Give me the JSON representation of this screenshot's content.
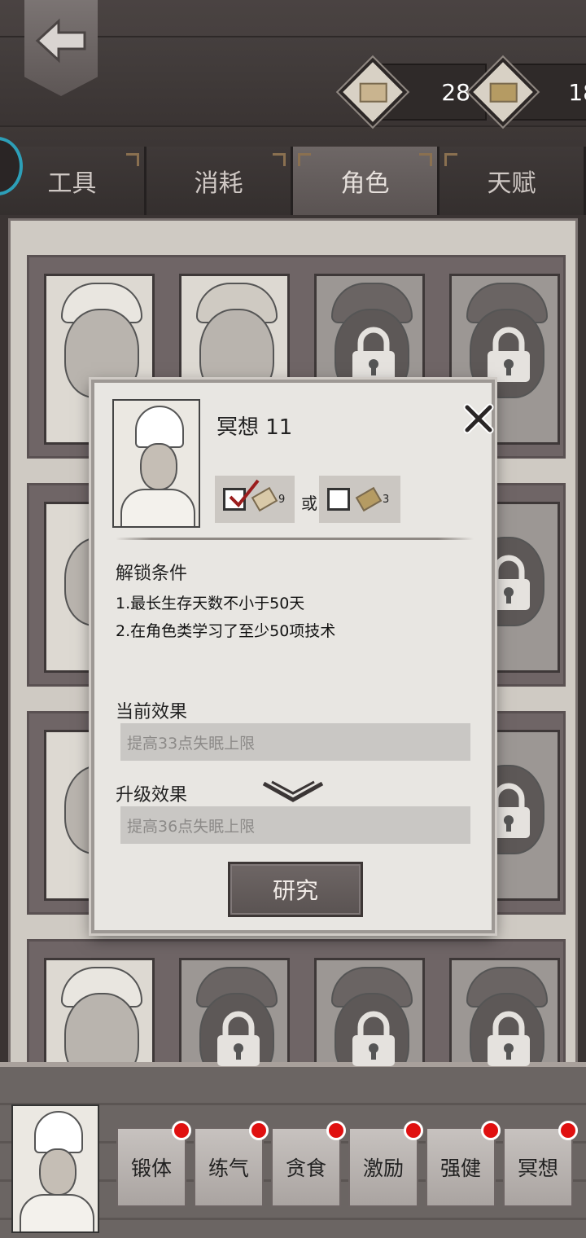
{
  "currencies": [
    {
      "icon": "scroll-icon",
      "value": "28"
    },
    {
      "icon": "book-icon",
      "value": "18"
    }
  ],
  "tabs": [
    "工具",
    "消耗",
    "角色",
    "天赋"
  ],
  "active_tab": "角色",
  "popup": {
    "title": "冥想 11",
    "cost_primary": {
      "icon": "scroll-icon",
      "amount": "9",
      "checked": true
    },
    "or_label": "或",
    "cost_secondary": {
      "icon": "book-icon",
      "amount": "3",
      "checked": false
    },
    "unlock_title": "解锁条件",
    "conditions": [
      "1.最长生存天数不小于50天",
      "2.在角色类学习了至少50项技术"
    ],
    "current_title": "当前效果",
    "current_effect": "提高33点失眠上限",
    "upgrade_title": "升级效果",
    "upgrade_effect": "提高36点失眠上限",
    "research_label": "研究"
  },
  "skills": [
    "锻体",
    "练气",
    "贪食",
    "激励",
    "强健",
    "冥想"
  ],
  "colors": {
    "accent_dot": "#e01010",
    "ring": "#2d9fb8"
  }
}
